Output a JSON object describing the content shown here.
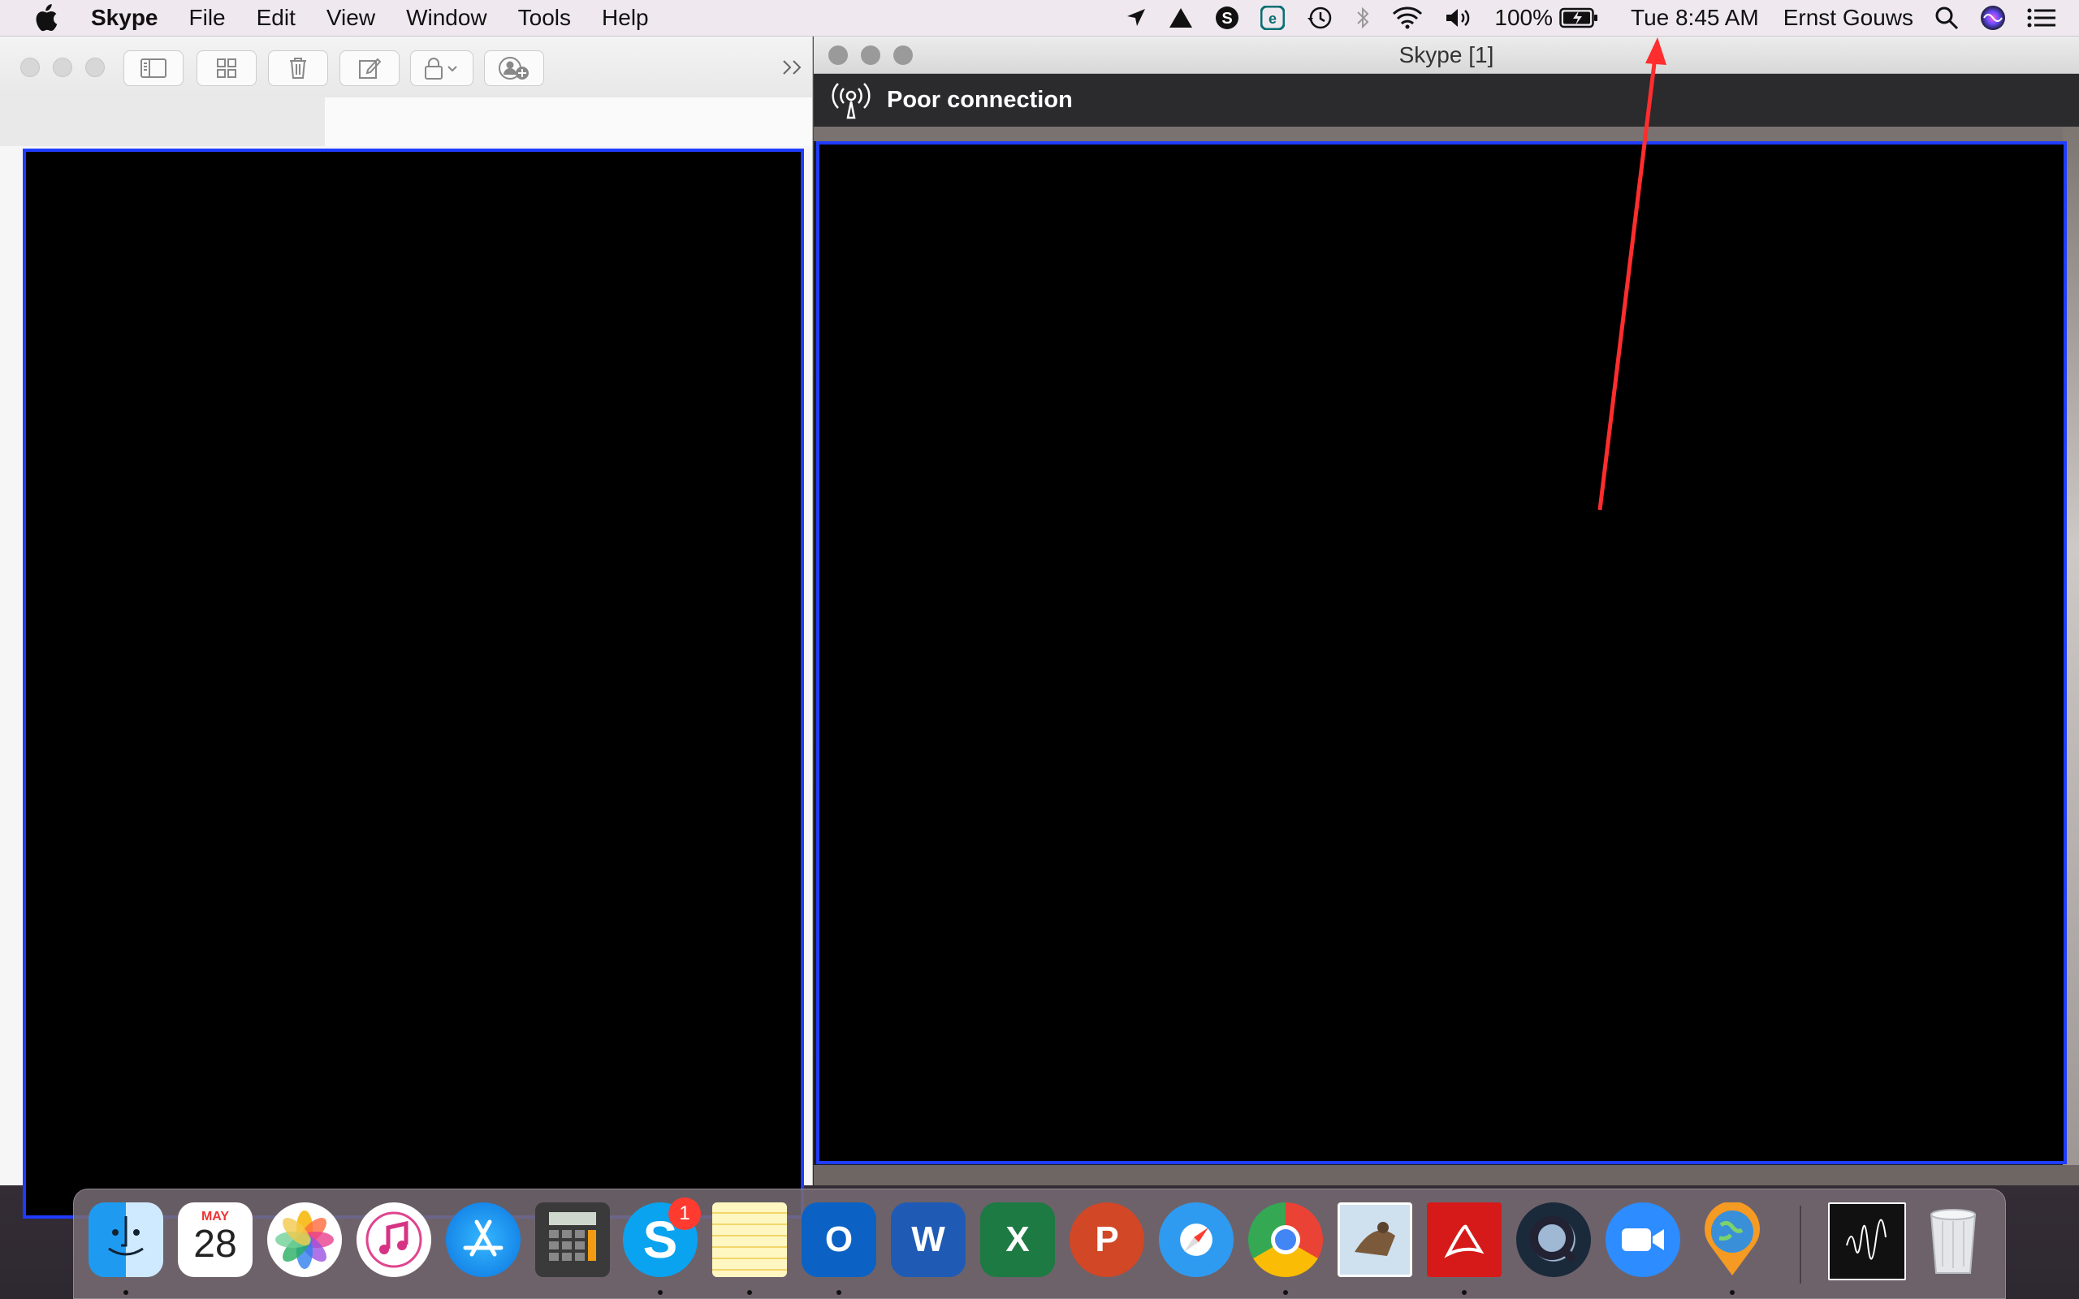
{
  "menubar": {
    "app_name": "Skype",
    "menus": [
      "File",
      "Edit",
      "View",
      "Window",
      "Tools",
      "Help"
    ],
    "status": {
      "battery_percent": "100%",
      "clock": "Tue 8:45 AM",
      "user_name": "Ernst Gouws",
      "icons": [
        "location-icon",
        "drive-icon",
        "skype-icon",
        "evernote-icon",
        "time-machine-icon",
        "bluetooth-icon",
        "wifi-icon",
        "volume-icon",
        "battery-icon",
        "spotlight-search-icon",
        "siri-icon",
        "notification-center-icon"
      ]
    }
  },
  "left_window": {
    "toolbar": [
      "sidebar-toggle-icon",
      "grid-view-icon",
      "trash-icon",
      "compose-icon",
      "lock-icon",
      "add-person-icon",
      "overflow-chevron-icon"
    ]
  },
  "call_window": {
    "title": "Skype [1]",
    "connection_status": "Poor connection"
  },
  "dock": {
    "calendar_month": "MAY",
    "calendar_day": "28",
    "skype_badge": "1",
    "apps": [
      "Finder",
      "Calendar",
      "Photos",
      "iTunes",
      "App Store",
      "Calculator",
      "Skype",
      "Notes",
      "Outlook",
      "Word",
      "Excel",
      "PowerPoint",
      "Safari",
      "Chrome",
      "Preview",
      "Acrobat",
      "QuickTime",
      "Zoom",
      "Globe",
      "Signature",
      "Trash"
    ]
  },
  "colors": {
    "highlight_border": "#1f3cff",
    "annotation_arrow": "#ff2d2d"
  }
}
